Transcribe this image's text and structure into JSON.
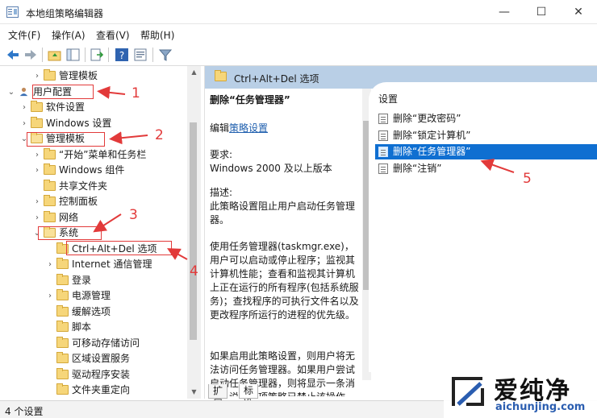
{
  "window": {
    "title": "本地组策略编辑器",
    "buttons": {
      "minimize": "—",
      "maximize": "☐",
      "close": "✕"
    }
  },
  "menu": [
    "文件(F)",
    "操作(A)",
    "查看(V)",
    "帮助(H)"
  ],
  "tree": [
    {
      "label": "管理模板",
      "arrow": "›",
      "indent": 2
    },
    {
      "label": "用户配置",
      "arrow": "⌄",
      "indent": 0,
      "kind": "user"
    },
    {
      "label": "软件设置",
      "arrow": "›",
      "indent": 1
    },
    {
      "label": "Windows 设置",
      "arrow": "›",
      "indent": 1
    },
    {
      "label": "管理模板",
      "arrow": "⌄",
      "indent": 1,
      "open": true
    },
    {
      "label": "“开始”菜单和任务栏",
      "arrow": "›",
      "indent": 2
    },
    {
      "label": "Windows 组件",
      "arrow": "›",
      "indent": 2
    },
    {
      "label": "共享文件夹",
      "arrow": "",
      "indent": 2
    },
    {
      "label": "控制面板",
      "arrow": "›",
      "indent": 2
    },
    {
      "label": "网络",
      "arrow": "›",
      "indent": 2
    },
    {
      "label": "系统",
      "arrow": "⌄",
      "indent": 2,
      "open": true
    },
    {
      "label": "Ctrl+Alt+Del 选项",
      "arrow": "",
      "indent": 3,
      "selected": true
    },
    {
      "label": "Internet 通信管理",
      "arrow": "›",
      "indent": 3
    },
    {
      "label": "登录",
      "arrow": "",
      "indent": 3
    },
    {
      "label": "电源管理",
      "arrow": "›",
      "indent": 3
    },
    {
      "label": "缓解选项",
      "arrow": "",
      "indent": 3
    },
    {
      "label": "脚本",
      "arrow": "",
      "indent": 3
    },
    {
      "label": "可移动存储访问",
      "arrow": "",
      "indent": 3
    },
    {
      "label": "区域设置服务",
      "arrow": "",
      "indent": 3
    },
    {
      "label": "驱动程序安装",
      "arrow": "",
      "indent": 3
    },
    {
      "label": "文件夹重定向",
      "arrow": "",
      "indent": 3
    }
  ],
  "right_header": "Ctrl+Alt+Del 选项",
  "detail": {
    "title": "删除“任务管理器”",
    "edit_prefix": "编辑",
    "edit_link": "策略设置",
    "req_label": "要求:",
    "req_value": "Windows 2000 及以上版本",
    "desc_label": "描述:",
    "desc_text": "此策略设置阻止用户启动任务管理器。",
    "para1": "使用任务管理器(taskmgr.exe)，用户可以启动或停止程序；监视其计算机性能；查看和监视其计算机上正在运行的所有程序(包括系统服务)；查找程序的可执行文件名以及更改程序所运行的进程的优先级。",
    "para2": "如果启用此策略设置，则用户将无法访问任务管理器。如果用户尝试启动任务管理器，则将显示一条消息，说明某项策略已禁止该操作。"
  },
  "list": {
    "column": "设置",
    "items": [
      "删除“更改密码”",
      "删除“锁定计算机”",
      "删除“任务管理器”",
      "删除“注销”"
    ],
    "selected_index": 2
  },
  "tabs": [
    "扩展",
    "标准"
  ],
  "status": "4 个设置",
  "annotations": [
    "1",
    "2",
    "3",
    "4",
    "5"
  ],
  "watermark": {
    "brand": "爱纯净",
    "url": "aichunjing.com"
  },
  "colors": {
    "accent": "#e23a3a",
    "selection": "#0f6fd1",
    "header_band": "#b9cfe6"
  }
}
